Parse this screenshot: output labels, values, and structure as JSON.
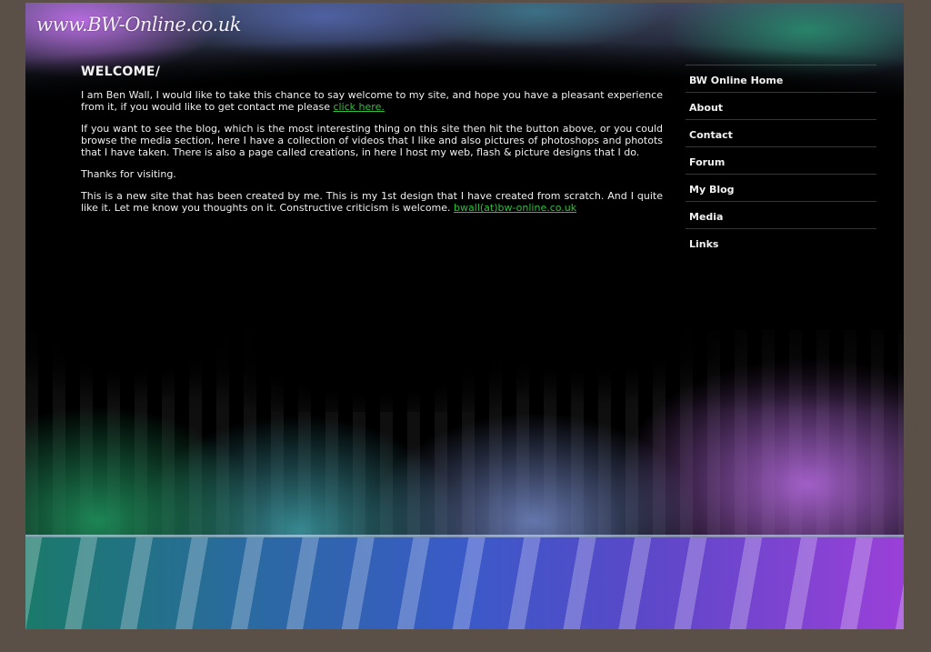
{
  "header": {
    "logo_text": "www.BW-Online.co.uk"
  },
  "main": {
    "title": "WELCOME/",
    "paragraphs": [
      {
        "text": "I am Ben Wall, I would like to take this chance to say welcome to my site, and hope you have a pleasant experience from it, if you would like to get contact me please ",
        "link": "click here."
      },
      {
        "text": "If you want to see the blog, which is the most interesting thing on this site then hit the button above, or you could browse the media section, here I have a collection of videos that I like and also pictures of photoshops and photots that I have taken. There is also a page called creations, in here I host my web, flash & picture designs that I do."
      },
      {
        "text": "Thanks for visiting."
      },
      {
        "text": "This is a new site that has been created by me. This is my 1st design that I have created from scratch. And I quite like it. Let me know you thoughts on it. Constructive criticism is welcome. ",
        "link": "bwall(at)bw-online.co.uk"
      }
    ]
  },
  "nav": {
    "items": [
      {
        "label": "BW Online Home"
      },
      {
        "label": "About"
      },
      {
        "label": "Contact"
      },
      {
        "label": "Forum"
      },
      {
        "label": "My Blog"
      },
      {
        "label": "Media"
      },
      {
        "label": "Links"
      }
    ]
  },
  "colors": {
    "page_bg": "#5b5048",
    "link": "#2fbf3a",
    "text": "#f0f0f0"
  }
}
